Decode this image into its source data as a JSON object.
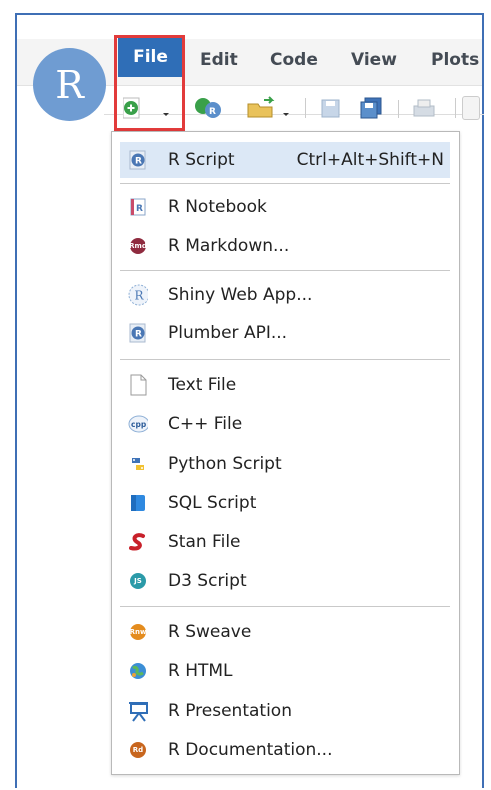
{
  "app": {
    "logo_letter": "R",
    "menubar": {
      "file": "File",
      "edit": "Edit",
      "code": "Code",
      "view": "View",
      "plots": "Plots"
    }
  },
  "new_file_menu": {
    "items": [
      {
        "label": "R Script",
        "shortcut": "Ctrl+Alt+Shift+N",
        "icon": "r-script-icon"
      },
      {
        "label": "R Notebook",
        "icon": "r-notebook-icon"
      },
      {
        "label": "R Markdown...",
        "icon": "r-markdown-icon"
      },
      {
        "label": "Shiny Web App...",
        "icon": "shiny-icon"
      },
      {
        "label": "Plumber API...",
        "icon": "plumber-icon"
      },
      {
        "label": "Text File",
        "icon": "text-file-icon"
      },
      {
        "label": "C++ File",
        "icon": "cpp-file-icon"
      },
      {
        "label": "Python Script",
        "icon": "python-icon"
      },
      {
        "label": "SQL Script",
        "icon": "sql-icon"
      },
      {
        "label": "Stan File",
        "icon": "stan-icon"
      },
      {
        "label": "D3 Script",
        "icon": "d3-icon"
      },
      {
        "label": "R Sweave",
        "icon": "sweave-icon"
      },
      {
        "label": "R HTML",
        "icon": "r-html-icon"
      },
      {
        "label": "R Presentation",
        "icon": "presentation-icon"
      },
      {
        "label": "R Documentation...",
        "icon": "r-doc-icon"
      }
    ]
  },
  "colors": {
    "accent": "#2f6eb7",
    "highlight_box": "#e23b3b",
    "hover_row": "#dce8f6"
  }
}
